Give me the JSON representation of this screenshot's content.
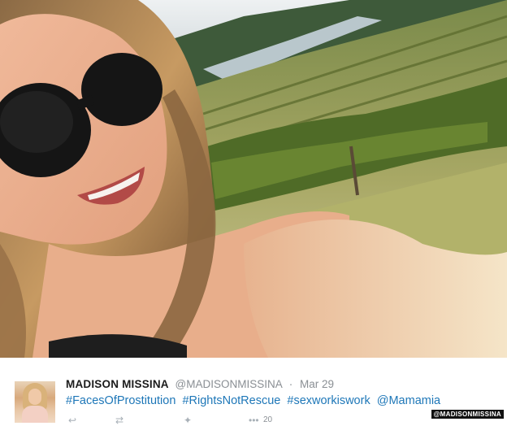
{
  "tweet": {
    "display_name": "MADISON MISSINA",
    "handle": "@MADISONMISSINA",
    "separator": "·",
    "date": "Mar 29",
    "hashtags": [
      "#FacesOfProstitution",
      "#RightsNotRescue",
      "#sexworkiswork",
      "@Mamamia"
    ],
    "retweet_count": "20"
  },
  "watermark": "@MADISONMISSINA",
  "icons": {
    "avatar": "profile-photo",
    "reply": "reply-icon",
    "retweet": "retweet-icon",
    "like": "like-icon",
    "more": "more-icon"
  },
  "colors": {
    "link": "#1e77b8",
    "muted": "#8a8f94",
    "name": "#1b1b1b"
  }
}
